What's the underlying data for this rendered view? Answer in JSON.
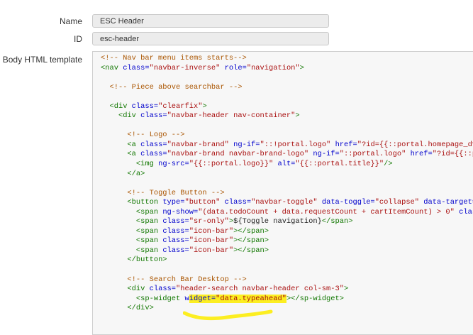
{
  "form": {
    "name_label": "Name",
    "name_value": "ESC Header",
    "id_label": "ID",
    "id_value": "esc-header",
    "body_label": "Body HTML template"
  },
  "code_lines": [
    [
      {
        "c": "cm",
        "t": "<!-- Nav bar menu items starts-->"
      }
    ],
    [
      {
        "c": "tg",
        "t": "<nav "
      },
      {
        "c": "at",
        "t": "class="
      },
      {
        "c": "st",
        "t": "\"navbar-inverse\""
      },
      {
        "c": "pl",
        "t": " "
      },
      {
        "c": "at",
        "t": "role="
      },
      {
        "c": "st",
        "t": "\"navigation\""
      },
      {
        "c": "tg",
        "t": ">"
      }
    ],
    [],
    [
      {
        "c": "pl",
        "t": "  "
      },
      {
        "c": "cm",
        "t": "<!-- Piece above searchbar -->"
      }
    ],
    [],
    [
      {
        "c": "pl",
        "t": "  "
      },
      {
        "c": "tg",
        "t": "<div "
      },
      {
        "c": "at",
        "t": "class="
      },
      {
        "c": "st",
        "t": "\"clearfix\""
      },
      {
        "c": "tg",
        "t": ">"
      }
    ],
    [
      {
        "c": "pl",
        "t": "    "
      },
      {
        "c": "tg",
        "t": "<div "
      },
      {
        "c": "at",
        "t": "class="
      },
      {
        "c": "st",
        "t": "\"navbar-header nav-container\""
      },
      {
        "c": "tg",
        "t": ">"
      }
    ],
    [],
    [
      {
        "c": "pl",
        "t": "      "
      },
      {
        "c": "cm",
        "t": "<!-- Logo -->"
      }
    ],
    [
      {
        "c": "pl",
        "t": "      "
      },
      {
        "c": "tg",
        "t": "<a "
      },
      {
        "c": "at",
        "t": "class="
      },
      {
        "c": "st",
        "t": "\"navbar-brand\""
      },
      {
        "c": "pl",
        "t": " "
      },
      {
        "c": "at",
        "t": "ng-if="
      },
      {
        "c": "st",
        "t": "\"::!portal.logo\""
      },
      {
        "c": "pl",
        "t": " "
      },
      {
        "c": "at",
        "t": "href="
      },
      {
        "c": "st",
        "t": "\"?id={{::portal.homepage_dv}}\""
      }
    ],
    [
      {
        "c": "pl",
        "t": "      "
      },
      {
        "c": "tg",
        "t": "<a "
      },
      {
        "c": "at",
        "t": "class="
      },
      {
        "c": "st",
        "t": "\"navbar-brand navbar-brand-logo\""
      },
      {
        "c": "pl",
        "t": " "
      },
      {
        "c": "at",
        "t": "ng-if="
      },
      {
        "c": "st",
        "t": "\"::portal.logo\""
      },
      {
        "c": "pl",
        "t": " "
      },
      {
        "c": "at",
        "t": "href="
      },
      {
        "c": "st",
        "t": "\"?id={{::portal"
      }
    ],
    [
      {
        "c": "pl",
        "t": "        "
      },
      {
        "c": "tg",
        "t": "<img "
      },
      {
        "c": "at",
        "t": "ng-src="
      },
      {
        "c": "st",
        "t": "\"{{::portal.logo}}\""
      },
      {
        "c": "pl",
        "t": " "
      },
      {
        "c": "at",
        "t": "alt="
      },
      {
        "c": "st",
        "t": "\"{{::portal.title}}\""
      },
      {
        "c": "tg",
        "t": "/>"
      }
    ],
    [
      {
        "c": "pl",
        "t": "      "
      },
      {
        "c": "tg",
        "t": "</a>"
      }
    ],
    [],
    [
      {
        "c": "pl",
        "t": "      "
      },
      {
        "c": "cm",
        "t": "<!-- Toggle Button -->"
      }
    ],
    [
      {
        "c": "pl",
        "t": "      "
      },
      {
        "c": "tg",
        "t": "<button "
      },
      {
        "c": "at",
        "t": "type="
      },
      {
        "c": "st",
        "t": "\"button\""
      },
      {
        "c": "pl",
        "t": " "
      },
      {
        "c": "at",
        "t": "class="
      },
      {
        "c": "st",
        "t": "\"navbar-toggle\""
      },
      {
        "c": "pl",
        "t": " "
      },
      {
        "c": "at",
        "t": "data-toggle="
      },
      {
        "c": "st",
        "t": "\"collapse\""
      },
      {
        "c": "pl",
        "t": " "
      },
      {
        "c": "at",
        "t": "data-target="
      },
      {
        "c": "st",
        "t": "\".na"
      }
    ],
    [
      {
        "c": "pl",
        "t": "        "
      },
      {
        "c": "tg",
        "t": "<span "
      },
      {
        "c": "at",
        "t": "ng-show="
      },
      {
        "c": "st",
        "t": "\"(data.todoCount + data.requestCount + cartItemCount) > 0\""
      },
      {
        "c": "pl",
        "t": " "
      },
      {
        "c": "at",
        "t": "class="
      },
      {
        "c": "st",
        "t": "\"l"
      }
    ],
    [
      {
        "c": "pl",
        "t": "        "
      },
      {
        "c": "tg",
        "t": "<span "
      },
      {
        "c": "at",
        "t": "class="
      },
      {
        "c": "st",
        "t": "\"sr-only\""
      },
      {
        "c": "tg",
        "t": ">"
      },
      {
        "c": "pl",
        "t": "${Toggle navigation}"
      },
      {
        "c": "tg",
        "t": "</span>"
      }
    ],
    [
      {
        "c": "pl",
        "t": "        "
      },
      {
        "c": "tg",
        "t": "<span "
      },
      {
        "c": "at",
        "t": "class="
      },
      {
        "c": "st",
        "t": "\"icon-bar\""
      },
      {
        "c": "tg",
        "t": "></span>"
      }
    ],
    [
      {
        "c": "pl",
        "t": "        "
      },
      {
        "c": "tg",
        "t": "<span "
      },
      {
        "c": "at",
        "t": "class="
      },
      {
        "c": "st",
        "t": "\"icon-bar\""
      },
      {
        "c": "tg",
        "t": "></span>"
      }
    ],
    [
      {
        "c": "pl",
        "t": "        "
      },
      {
        "c": "tg",
        "t": "<span "
      },
      {
        "c": "at",
        "t": "class="
      },
      {
        "c": "st",
        "t": "\"icon-bar\""
      },
      {
        "c": "tg",
        "t": "></span>"
      }
    ],
    [
      {
        "c": "pl",
        "t": "      "
      },
      {
        "c": "tg",
        "t": "</button>"
      }
    ],
    [],
    [
      {
        "c": "pl",
        "t": "      "
      },
      {
        "c": "cm",
        "t": "<!-- Search Bar Desktop -->"
      }
    ],
    [
      {
        "c": "pl",
        "t": "      "
      },
      {
        "c": "tg",
        "t": "<div "
      },
      {
        "c": "at",
        "t": "class="
      },
      {
        "c": "st",
        "t": "\"header-search navbar-header col-sm-3\""
      },
      {
        "c": "tg",
        "t": ">"
      }
    ],
    [
      {
        "c": "pl",
        "t": "        "
      },
      {
        "c": "tg",
        "t": "<sp-widget "
      },
      {
        "c": "at",
        "t": "w"
      },
      {
        "c": "at hl",
        "t": "idget="
      },
      {
        "c": "st hl",
        "t": "\"data.typeahead\""
      },
      {
        "c": "tg",
        "t": "></sp-widget>"
      }
    ],
    [
      {
        "c": "pl",
        "t": "      "
      },
      {
        "c": "tg",
        "t": "</div>"
      }
    ]
  ],
  "colors": {
    "highlight": "#fcee21",
    "tag": "#117700",
    "attribute": "#0000cc",
    "string": "#aa1111",
    "comment": "#aa5500"
  }
}
